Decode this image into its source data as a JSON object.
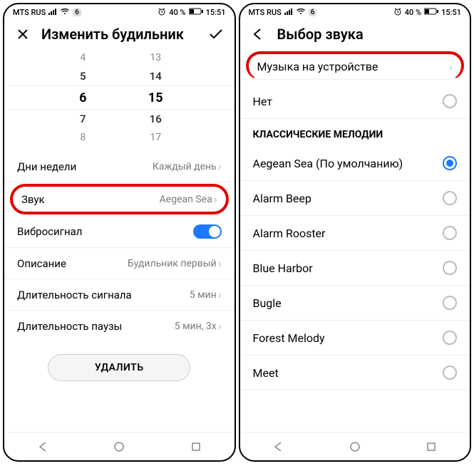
{
  "status": {
    "carrier": "MTS RUS",
    "badge": "6",
    "battery": "40 %",
    "time": "15:51"
  },
  "screen1": {
    "title": "Изменить будильник",
    "picker": {
      "r0": [
        "4",
        "13"
      ],
      "r1": [
        "5",
        "14"
      ],
      "sel": [
        "6",
        "15"
      ],
      "r3": [
        "7",
        "16"
      ],
      "r4": [
        "8",
        "17"
      ]
    },
    "rows": {
      "days_label": "Дни недели",
      "days_val": "Каждый день",
      "sound_label": "Звук",
      "sound_val": "Aegean Sea",
      "vib_label": "Вибросигнал",
      "desc_label": "Описание",
      "desc_val": "Будильник первый",
      "sig_label": "Длительность сигнала",
      "sig_val": "5 мин",
      "pause_label": "Длительность паузы",
      "pause_val": "5 мин, 3x"
    },
    "delete": "УДАЛИТЬ"
  },
  "screen2": {
    "title": "Выбор звука",
    "music_row": "Музыка на устройстве",
    "none": "Нет",
    "section": "КЛАССИЧЕСКИЕ МЕЛОДИИ",
    "items": [
      "Aegean Sea (По умолчанию)",
      "Alarm Beep",
      "Alarm Rooster",
      "Blue Harbor",
      "Bugle",
      "Forest Melody",
      "Meet"
    ]
  }
}
